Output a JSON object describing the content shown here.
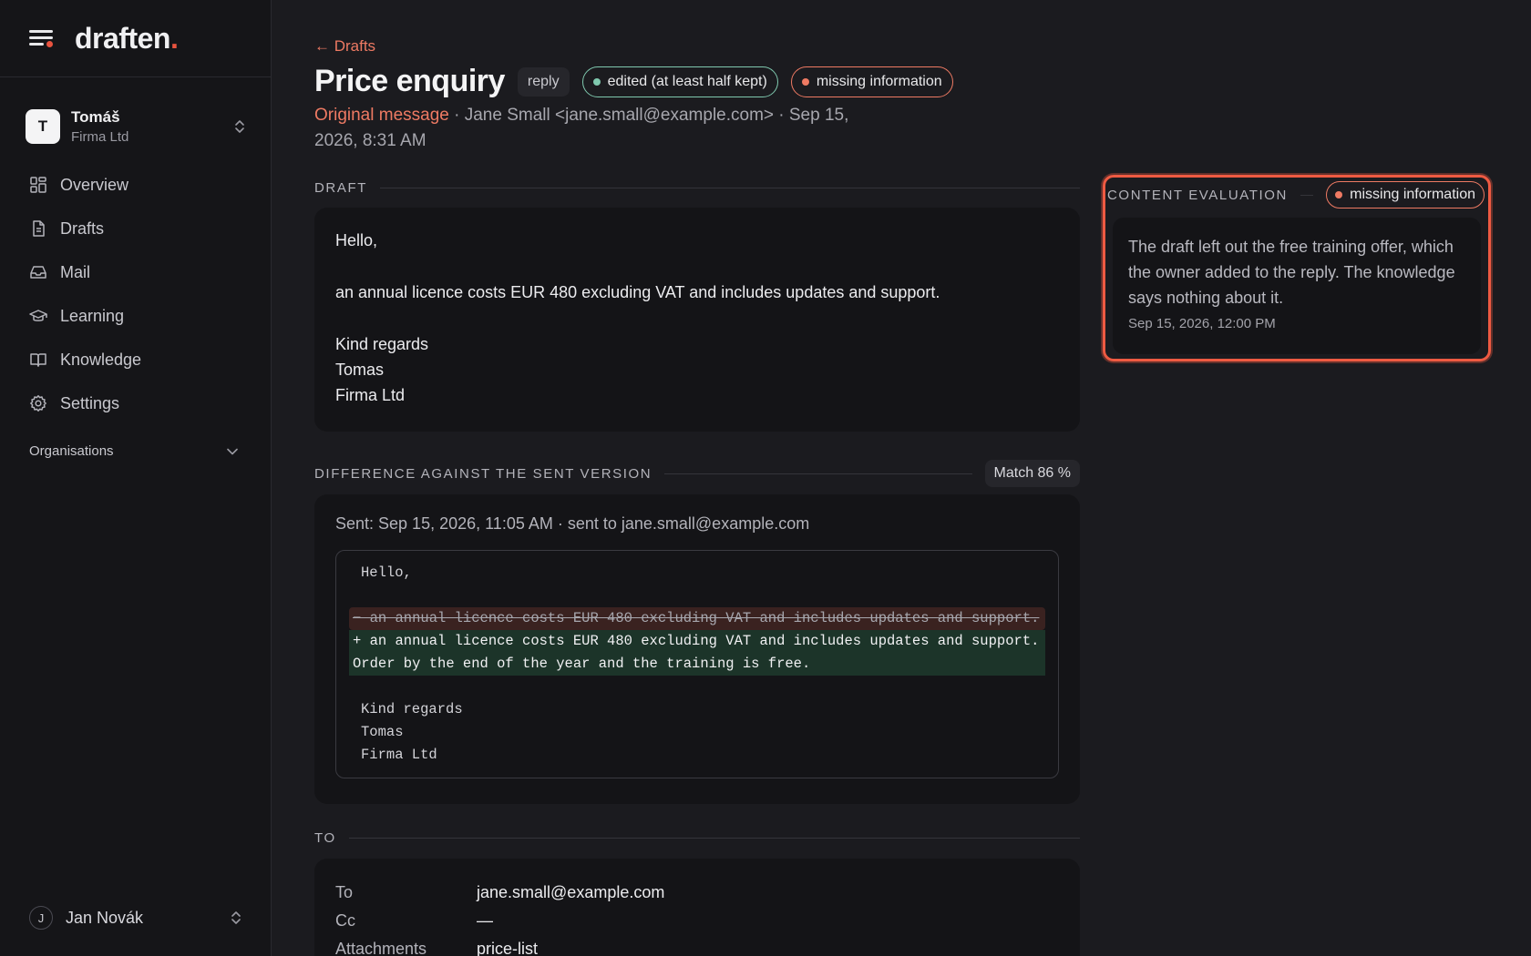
{
  "brand": {
    "name": "draften",
    "accent": "."
  },
  "org": {
    "initial": "T",
    "name": "Tomáš",
    "sub": "Firma Ltd"
  },
  "nav": [
    {
      "label": "Overview",
      "icon": "grid-icon"
    },
    {
      "label": "Drafts",
      "icon": "document-icon"
    },
    {
      "label": "Mail",
      "icon": "inbox-icon"
    },
    {
      "label": "Learning",
      "icon": "graduation-cap-icon"
    },
    {
      "label": "Knowledge",
      "icon": "book-icon"
    },
    {
      "label": "Settings",
      "icon": "gear-icon"
    }
  ],
  "organisations_label": "Organisations",
  "user": {
    "initial": "J",
    "name": "Jan Novák"
  },
  "back_label": "← Drafts",
  "title": "Price enquiry",
  "badges": {
    "type": "reply",
    "edit_status": "edited (at least half kept)",
    "content_status": "missing information"
  },
  "meta": {
    "original_label": "Original message",
    "rest": " · Jane Small <jane.small@example.com> · Sep 15, 2026, 8:31 AM"
  },
  "draft": {
    "section_title": "DRAFT",
    "paragraphs": [
      "Hello,",
      "an annual licence costs EUR 480 excluding VAT and includes updates and support.",
      "Kind regards\nTomas\nFirma Ltd"
    ],
    "greeting": "Hello,",
    "body": "an annual licence costs EUR 480 excluding VAT and includes updates and support.",
    "closing": "Kind regards",
    "sign_name": "Tomas",
    "sign_company": "Firma Ltd"
  },
  "diff": {
    "section_title": "DIFFERENCE AGAINST THE SENT VERSION",
    "match_label": "Match 86 %",
    "sent_line": "Sent: Sep 15, 2026, 11:05 AM · sent to jane.small@example.com",
    "line_greeting": "Hello,",
    "line_removed": "− an annual licence costs EUR 480 excluding VAT and includes updates and support.",
    "line_added": "+ an annual licence costs EUR 480 excluding VAT and includes updates and support. Order by the end of the year and the training is free.",
    "line_closing": "Kind regards",
    "line_name": "Tomas",
    "line_company": "Firma Ltd"
  },
  "to": {
    "section_title": "TO",
    "to_label": "To",
    "to_value": "jane.small@example.com",
    "cc_label": "Cc",
    "cc_value": "—",
    "att_label": "Attachments",
    "att_value": "price-list"
  },
  "evaluation": {
    "section_title": "CONTENT EVALUATION",
    "status": "missing information",
    "text": "The draft left out the free training offer, which the owner added to the reply. The knowledge says nothing about it.",
    "time": "Sep 15, 2026, 12:00 PM"
  },
  "colors": {
    "accent": "#ee7a63",
    "highlight_border": "#ee5a42",
    "ok_green": "#7fc8ae",
    "diff_removed_bg": "#3a2220",
    "diff_added_bg": "#1c3429"
  }
}
